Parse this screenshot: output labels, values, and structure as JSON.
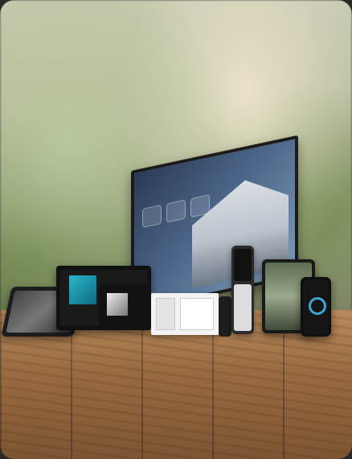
{
  "scene": {
    "description_type": "smart-home device lineup on wooden table",
    "devices": [
      {
        "name": "tv"
      },
      {
        "name": "tablet-left"
      },
      {
        "name": "touch-panel"
      },
      {
        "name": "music-panel"
      },
      {
        "name": "keypad-thermostat"
      },
      {
        "name": "slim-remote"
      },
      {
        "name": "small-remote"
      },
      {
        "name": "ipad"
      },
      {
        "name": "phone"
      }
    ]
  },
  "colors": {
    "background": "#a9ad8d",
    "table": "#9a6c42",
    "accent": "#3fa7d6"
  }
}
